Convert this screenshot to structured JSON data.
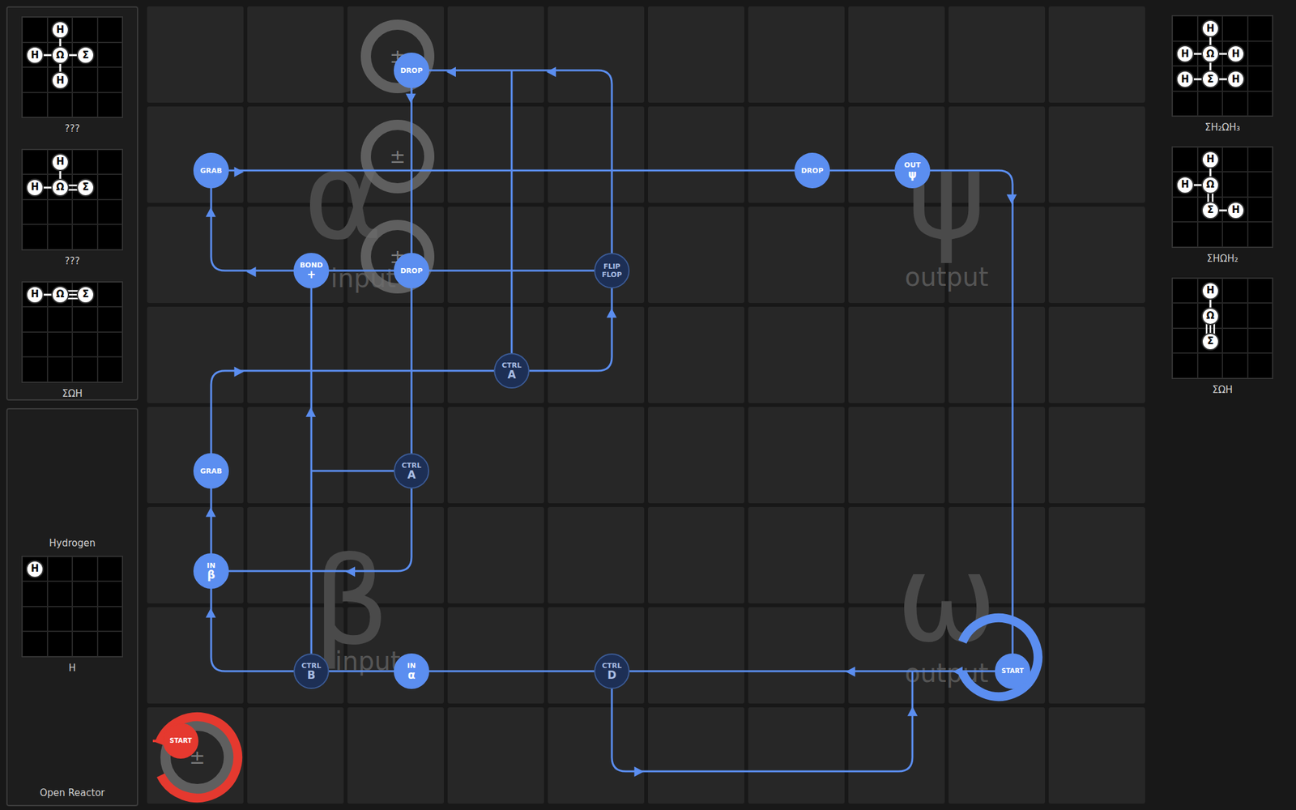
{
  "reactor": {
    "name": "Open Reactor"
  },
  "inputs": [
    {
      "label": "???",
      "atoms": [
        {
          "symbol": "H",
          "col": 1,
          "row": 0
        },
        {
          "symbol": "H",
          "col": 0,
          "row": 1
        },
        {
          "symbol": "Ω",
          "col": 1,
          "row": 1
        },
        {
          "symbol": "Σ",
          "col": 2,
          "row": 1
        },
        {
          "symbol": "H",
          "col": 1,
          "row": 2
        }
      ],
      "bonds": [
        {
          "from": 0,
          "to": 2,
          "order": 1
        },
        {
          "from": 1,
          "to": 2,
          "order": 1
        },
        {
          "from": 2,
          "to": 3,
          "order": 1
        },
        {
          "from": 2,
          "to": 4,
          "order": 1
        }
      ]
    },
    {
      "label": "???",
      "atoms": [
        {
          "symbol": "H",
          "col": 1,
          "row": 0
        },
        {
          "symbol": "H",
          "col": 0,
          "row": 1
        },
        {
          "symbol": "Ω",
          "col": 1,
          "row": 1
        },
        {
          "symbol": "Σ",
          "col": 2,
          "row": 1
        }
      ],
      "bonds": [
        {
          "from": 0,
          "to": 2,
          "order": 1
        },
        {
          "from": 1,
          "to": 2,
          "order": 1
        },
        {
          "from": 2,
          "to": 3,
          "order": 2
        }
      ]
    },
    {
      "label": "ΣΩH",
      "atoms": [
        {
          "symbol": "H",
          "col": 0,
          "row": 0
        },
        {
          "symbol": "Ω",
          "col": 1,
          "row": 0
        },
        {
          "symbol": "Σ",
          "col": 2,
          "row": 0
        }
      ],
      "bonds": [
        {
          "from": 0,
          "to": 1,
          "order": 1
        },
        {
          "from": 1,
          "to": 2,
          "order": 3
        }
      ]
    }
  ],
  "reagent": {
    "title": "Hydrogen",
    "label": "H",
    "atoms": [
      {
        "symbol": "H",
        "col": 0,
        "row": 0
      }
    ],
    "bonds": []
  },
  "outputs": [
    {
      "label": "ΣH₂ΩH₃",
      "atoms": [
        {
          "symbol": "H",
          "col": 1,
          "row": 0
        },
        {
          "symbol": "H",
          "col": 0,
          "row": 1
        },
        {
          "symbol": "Ω",
          "col": 1,
          "row": 1
        },
        {
          "symbol": "H",
          "col": 2,
          "row": 1
        },
        {
          "symbol": "H",
          "col": 0,
          "row": 2
        },
        {
          "symbol": "Σ",
          "col": 1,
          "row": 2
        },
        {
          "symbol": "H",
          "col": 2,
          "row": 2
        }
      ],
      "bonds": [
        {
          "from": 0,
          "to": 2,
          "order": 1
        },
        {
          "from": 1,
          "to": 2,
          "order": 1
        },
        {
          "from": 2,
          "to": 3,
          "order": 1
        },
        {
          "from": 2,
          "to": 5,
          "order": 1
        },
        {
          "from": 4,
          "to": 5,
          "order": 1
        },
        {
          "from": 5,
          "to": 6,
          "order": 1
        }
      ]
    },
    {
      "label": "ΣHΩH₂",
      "atoms": [
        {
          "symbol": "H",
          "col": 1,
          "row": 0
        },
        {
          "symbol": "H",
          "col": 0,
          "row": 1
        },
        {
          "symbol": "Ω",
          "col": 1,
          "row": 1
        },
        {
          "symbol": "Σ",
          "col": 1,
          "row": 2
        },
        {
          "symbol": "H",
          "col": 2,
          "row": 2
        }
      ],
      "bonds": [
        {
          "from": 0,
          "to": 2,
          "order": 1
        },
        {
          "from": 1,
          "to": 2,
          "order": 1
        },
        {
          "from": 2,
          "to": 3,
          "order": 2
        },
        {
          "from": 3,
          "to": 4,
          "order": 1
        }
      ]
    },
    {
      "label": "ΣΩH",
      "atoms": [
        {
          "symbol": "H",
          "col": 1,
          "row": 0
        },
        {
          "symbol": "Ω",
          "col": 1,
          "row": 1
        },
        {
          "symbol": "Σ",
          "col": 1,
          "row": 2
        }
      ],
      "bonds": [
        {
          "from": 0,
          "to": 1,
          "order": 1
        },
        {
          "from": 1,
          "to": 2,
          "order": 3
        }
      ]
    }
  ],
  "zones": [
    {
      "symbol": "α",
      "caption": "input"
    },
    {
      "symbol": "β",
      "caption": "input"
    },
    {
      "symbol": "ψ",
      "caption": "output"
    },
    {
      "symbol": "ω",
      "caption": "output"
    }
  ],
  "bonders": [
    {
      "label": "±",
      "col": 2,
      "row": 0
    },
    {
      "label": "±",
      "col": 2,
      "row": 1
    },
    {
      "label": "±",
      "col": 2,
      "row": 2
    },
    {
      "label": "±",
      "col": 0,
      "row": 7
    }
  ],
  "waldos": [
    {
      "name": "red",
      "color": "#e5392f"
    },
    {
      "name": "blue",
      "color": "#5b8ef0"
    }
  ],
  "instructions": [
    {
      "label": "DROP",
      "sub": "",
      "kind": "action",
      "waldo": "blue",
      "col": 2,
      "row": 0
    },
    {
      "label": "GRAB",
      "sub": "",
      "kind": "action",
      "waldo": "blue",
      "col": 0,
      "row": 1
    },
    {
      "label": "DROP",
      "sub": "",
      "kind": "action",
      "waldo": "blue",
      "col": 6,
      "row": 1
    },
    {
      "label": "OUT",
      "sub": "ψ",
      "kind": "action",
      "waldo": "blue",
      "col": 7,
      "row": 1
    },
    {
      "label": "BOND",
      "sub": "+",
      "kind": "action",
      "waldo": "blue",
      "col": 1,
      "row": 2
    },
    {
      "label": "DROP",
      "sub": "",
      "kind": "action",
      "waldo": "blue",
      "col": 2,
      "row": 2
    },
    {
      "label": "FLIP",
      "sub": "FLOP",
      "kind": "control",
      "waldo": "blue",
      "col": 4,
      "row": 2
    },
    {
      "label": "CTRL",
      "sub": "A",
      "kind": "control",
      "waldo": "blue",
      "col": 3,
      "row": 3
    },
    {
      "label": "GRAB",
      "sub": "",
      "kind": "action",
      "waldo": "blue",
      "col": 0,
      "row": 4
    },
    {
      "label": "CTRL",
      "sub": "A",
      "kind": "control",
      "waldo": "blue",
      "col": 2,
      "row": 4
    },
    {
      "label": "IN",
      "sub": "β",
      "kind": "action",
      "waldo": "blue",
      "col": 0,
      "row": 5
    },
    {
      "label": "CTRL",
      "sub": "B",
      "kind": "control",
      "waldo": "blue",
      "col": 1,
      "row": 6
    },
    {
      "label": "IN",
      "sub": "α",
      "kind": "action",
      "waldo": "blue",
      "col": 2,
      "row": 6
    },
    {
      "label": "CTRL",
      "sub": "D",
      "kind": "control",
      "waldo": "blue",
      "col": 4,
      "row": 6
    },
    {
      "label": "START",
      "sub": "",
      "kind": "start",
      "waldo": "blue",
      "col": 8,
      "row": 6
    },
    {
      "label": "START",
      "sub": "",
      "kind": "start",
      "waldo": "red",
      "col": 0,
      "row": 7
    }
  ]
}
